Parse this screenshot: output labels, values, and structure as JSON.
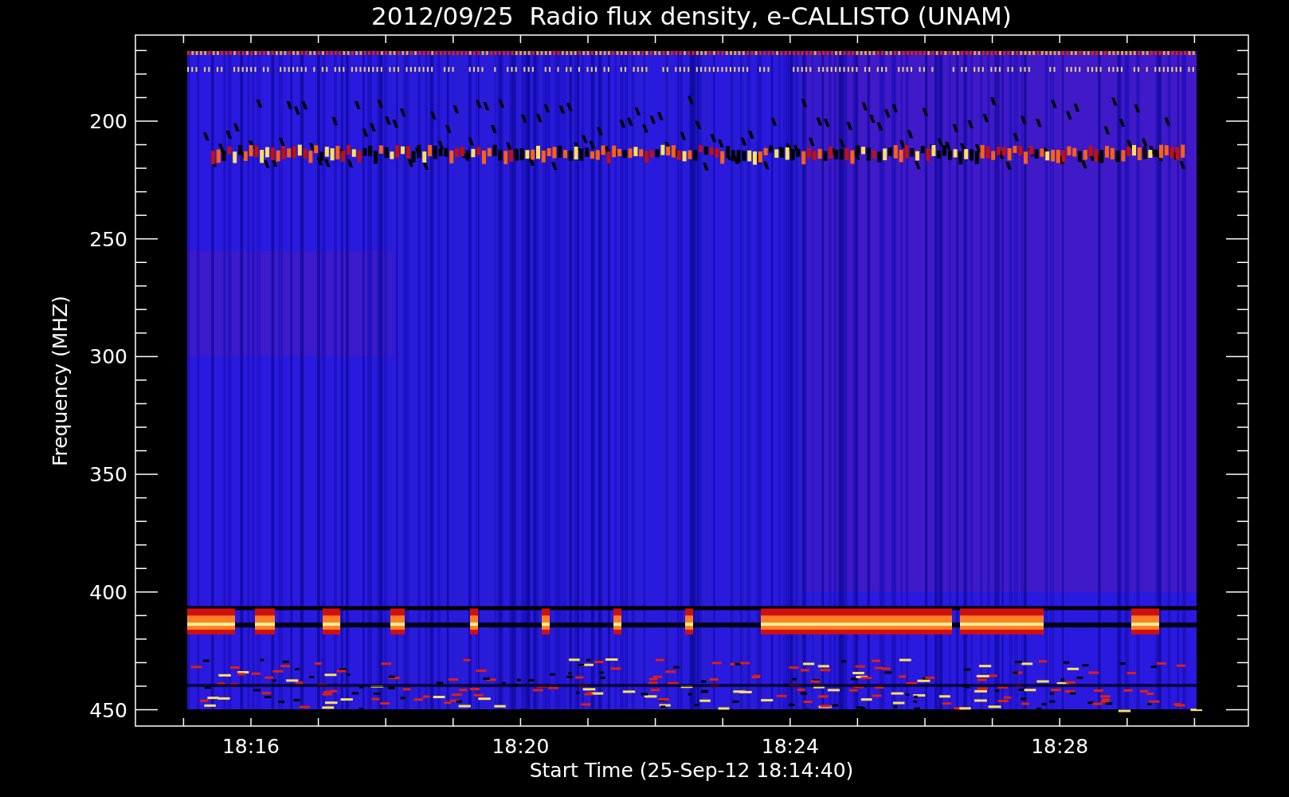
{
  "title": "2012/09/25  Radio flux density, e-CALLISTO (UNAM)",
  "y_axis": {
    "label": "Frequency (MHZ)",
    "ticks": [
      "200",
      "250",
      "300",
      "350",
      "400",
      "450"
    ]
  },
  "x_axis": {
    "label": "Start Time (25-Sep-12 18:14:40)",
    "ticks": [
      "18:16",
      "18:20",
      "18:24",
      "18:28"
    ]
  }
}
